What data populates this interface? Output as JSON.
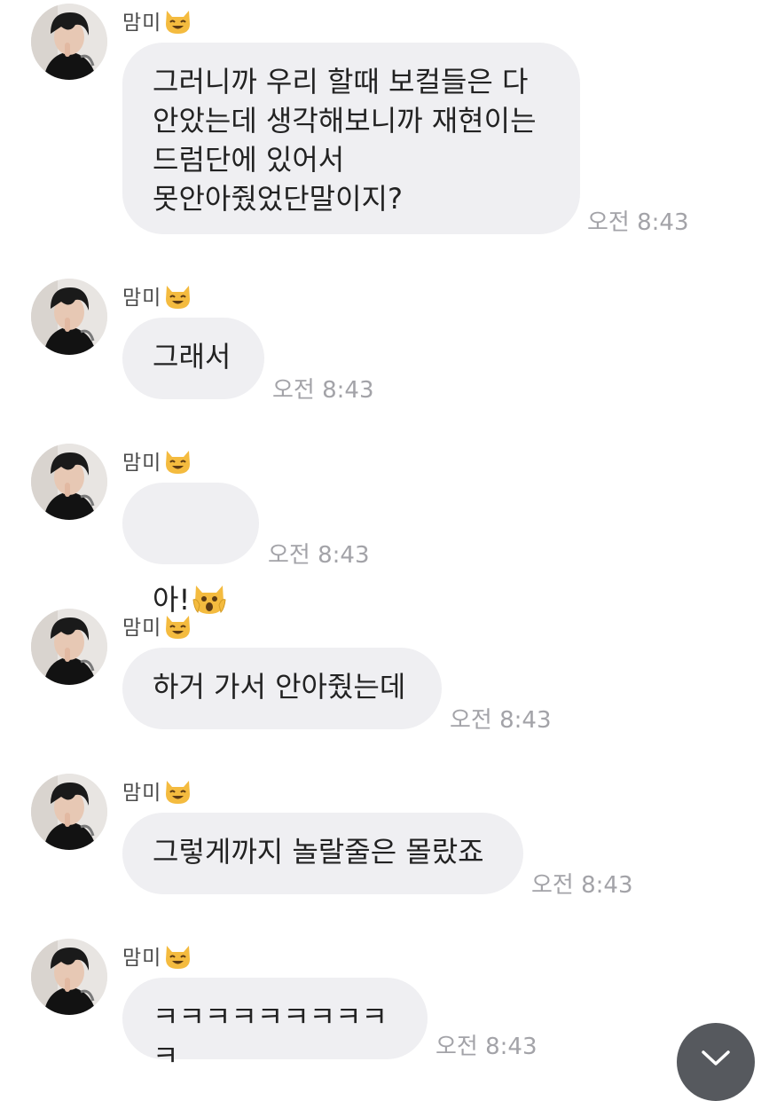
{
  "chat": {
    "messages": [
      {
        "sender": "맘미",
        "text": "그러니까 우리 할때 보컬들은 다\n안았는데 생각해보니까 재현이는\n드럼단에 있어서\n못안아줬었단말이지?",
        "time": "오전 8:43"
      },
      {
        "sender": "맘미",
        "text": "그래서",
        "time": "오전 8:43"
      },
      {
        "sender": "맘미",
        "text": "아!",
        "emoji": "scream-cat-emoji",
        "time": "오전 8:43"
      },
      {
        "sender": "맘미",
        "text": "하거 가서 안아줬는데",
        "time": "오전 8:43"
      },
      {
        "sender": "맘미",
        "text": "그렇게까지 놀랄줄은 몰랐죠",
        "time": "오전 8:43"
      },
      {
        "sender": "맘미",
        "text": "ㅋㅋㅋㅋㅋㅋㅋㅋㅋㅋ",
        "time": "오전 8:43"
      }
    ]
  },
  "icons": {
    "name_badge": "smiling-cat-icon",
    "scroll_button": "chevron-down-icon"
  },
  "colors": {
    "bubble": "#efeff2",
    "timestamp": "#a3a3a8",
    "scroll_button": "#56595e",
    "cat_fill": "#f4bb3f"
  }
}
